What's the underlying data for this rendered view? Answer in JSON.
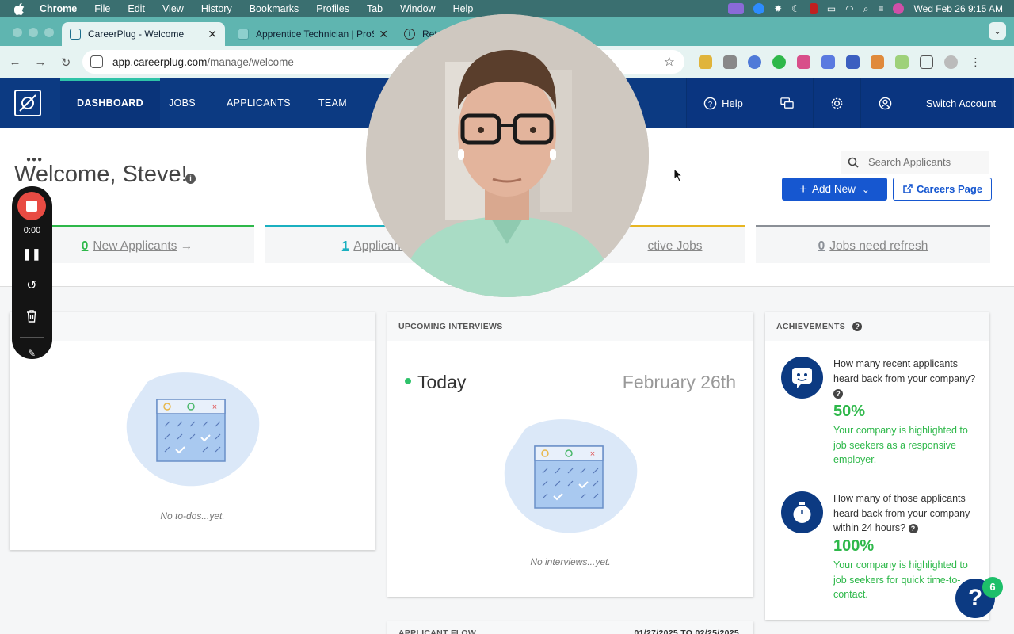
{
  "macbar": {
    "app": "Chrome",
    "menus": [
      "File",
      "Edit",
      "View",
      "History",
      "Bookmarks",
      "Profiles",
      "Tab",
      "Window",
      "Help"
    ],
    "datetime": "Wed Feb 26  9:15 AM"
  },
  "browser": {
    "tabs": [
      {
        "title": "CareerPlug - Welcome",
        "active": true
      },
      {
        "title": "Apprentice Technician | ProS"
      },
      {
        "title": "Retail"
      }
    ],
    "url_host": "app.careerplug.com",
    "url_path": "/manage/welcome"
  },
  "nav": {
    "items": [
      "DASHBOARD",
      "JOBS",
      "APPLICANTS",
      "TEAM"
    ],
    "help": "Help",
    "switch_account": "Switch Account"
  },
  "header": {
    "welcome": "Welcome, Steve!",
    "search_placeholder": "Search Applicants",
    "add_new": "Add New",
    "careers_page": "Careers Page"
  },
  "stats": [
    {
      "num": "0",
      "label": "New Applicants",
      "suffix": " →",
      "color": "#2eb84a"
    },
    {
      "num": "1",
      "label": "Applicants in",
      "color": "#1ab0c0"
    },
    {
      "num": "",
      "label": "ctive Jobs",
      "color": "#e7b622"
    },
    {
      "num": "0",
      "label": "Jobs need refresh",
      "color": "#8a8f96"
    }
  ],
  "todos": {
    "empty": "No to-dos...yet."
  },
  "interviews": {
    "title": "UPCOMING INTERVIEWS",
    "today": "Today",
    "date": "February 26th",
    "empty": "No interviews...yet."
  },
  "achievements": {
    "title": "ACHIEVEMENTS",
    "items": [
      {
        "question": "How many recent applicants heard back from your company?",
        "percent": "50%",
        "desc": "Your company is highlighted to job seekers as a responsive employer."
      },
      {
        "question": "How many of those applicants heard back from your company within 24 hours?",
        "percent": "100%",
        "desc": "Your company is highlighted to job seekers for quick time-to-contact."
      }
    ]
  },
  "recorder": {
    "time": "0:00"
  },
  "applicant_flow": {
    "title": "APPLICANT FLOW",
    "range": "01/27/2025  to  02/25/2025"
  },
  "help_badge": "6",
  "colors": {
    "nav": "#0c3a82",
    "accent": "#1657d0",
    "success": "#2eb84a"
  }
}
